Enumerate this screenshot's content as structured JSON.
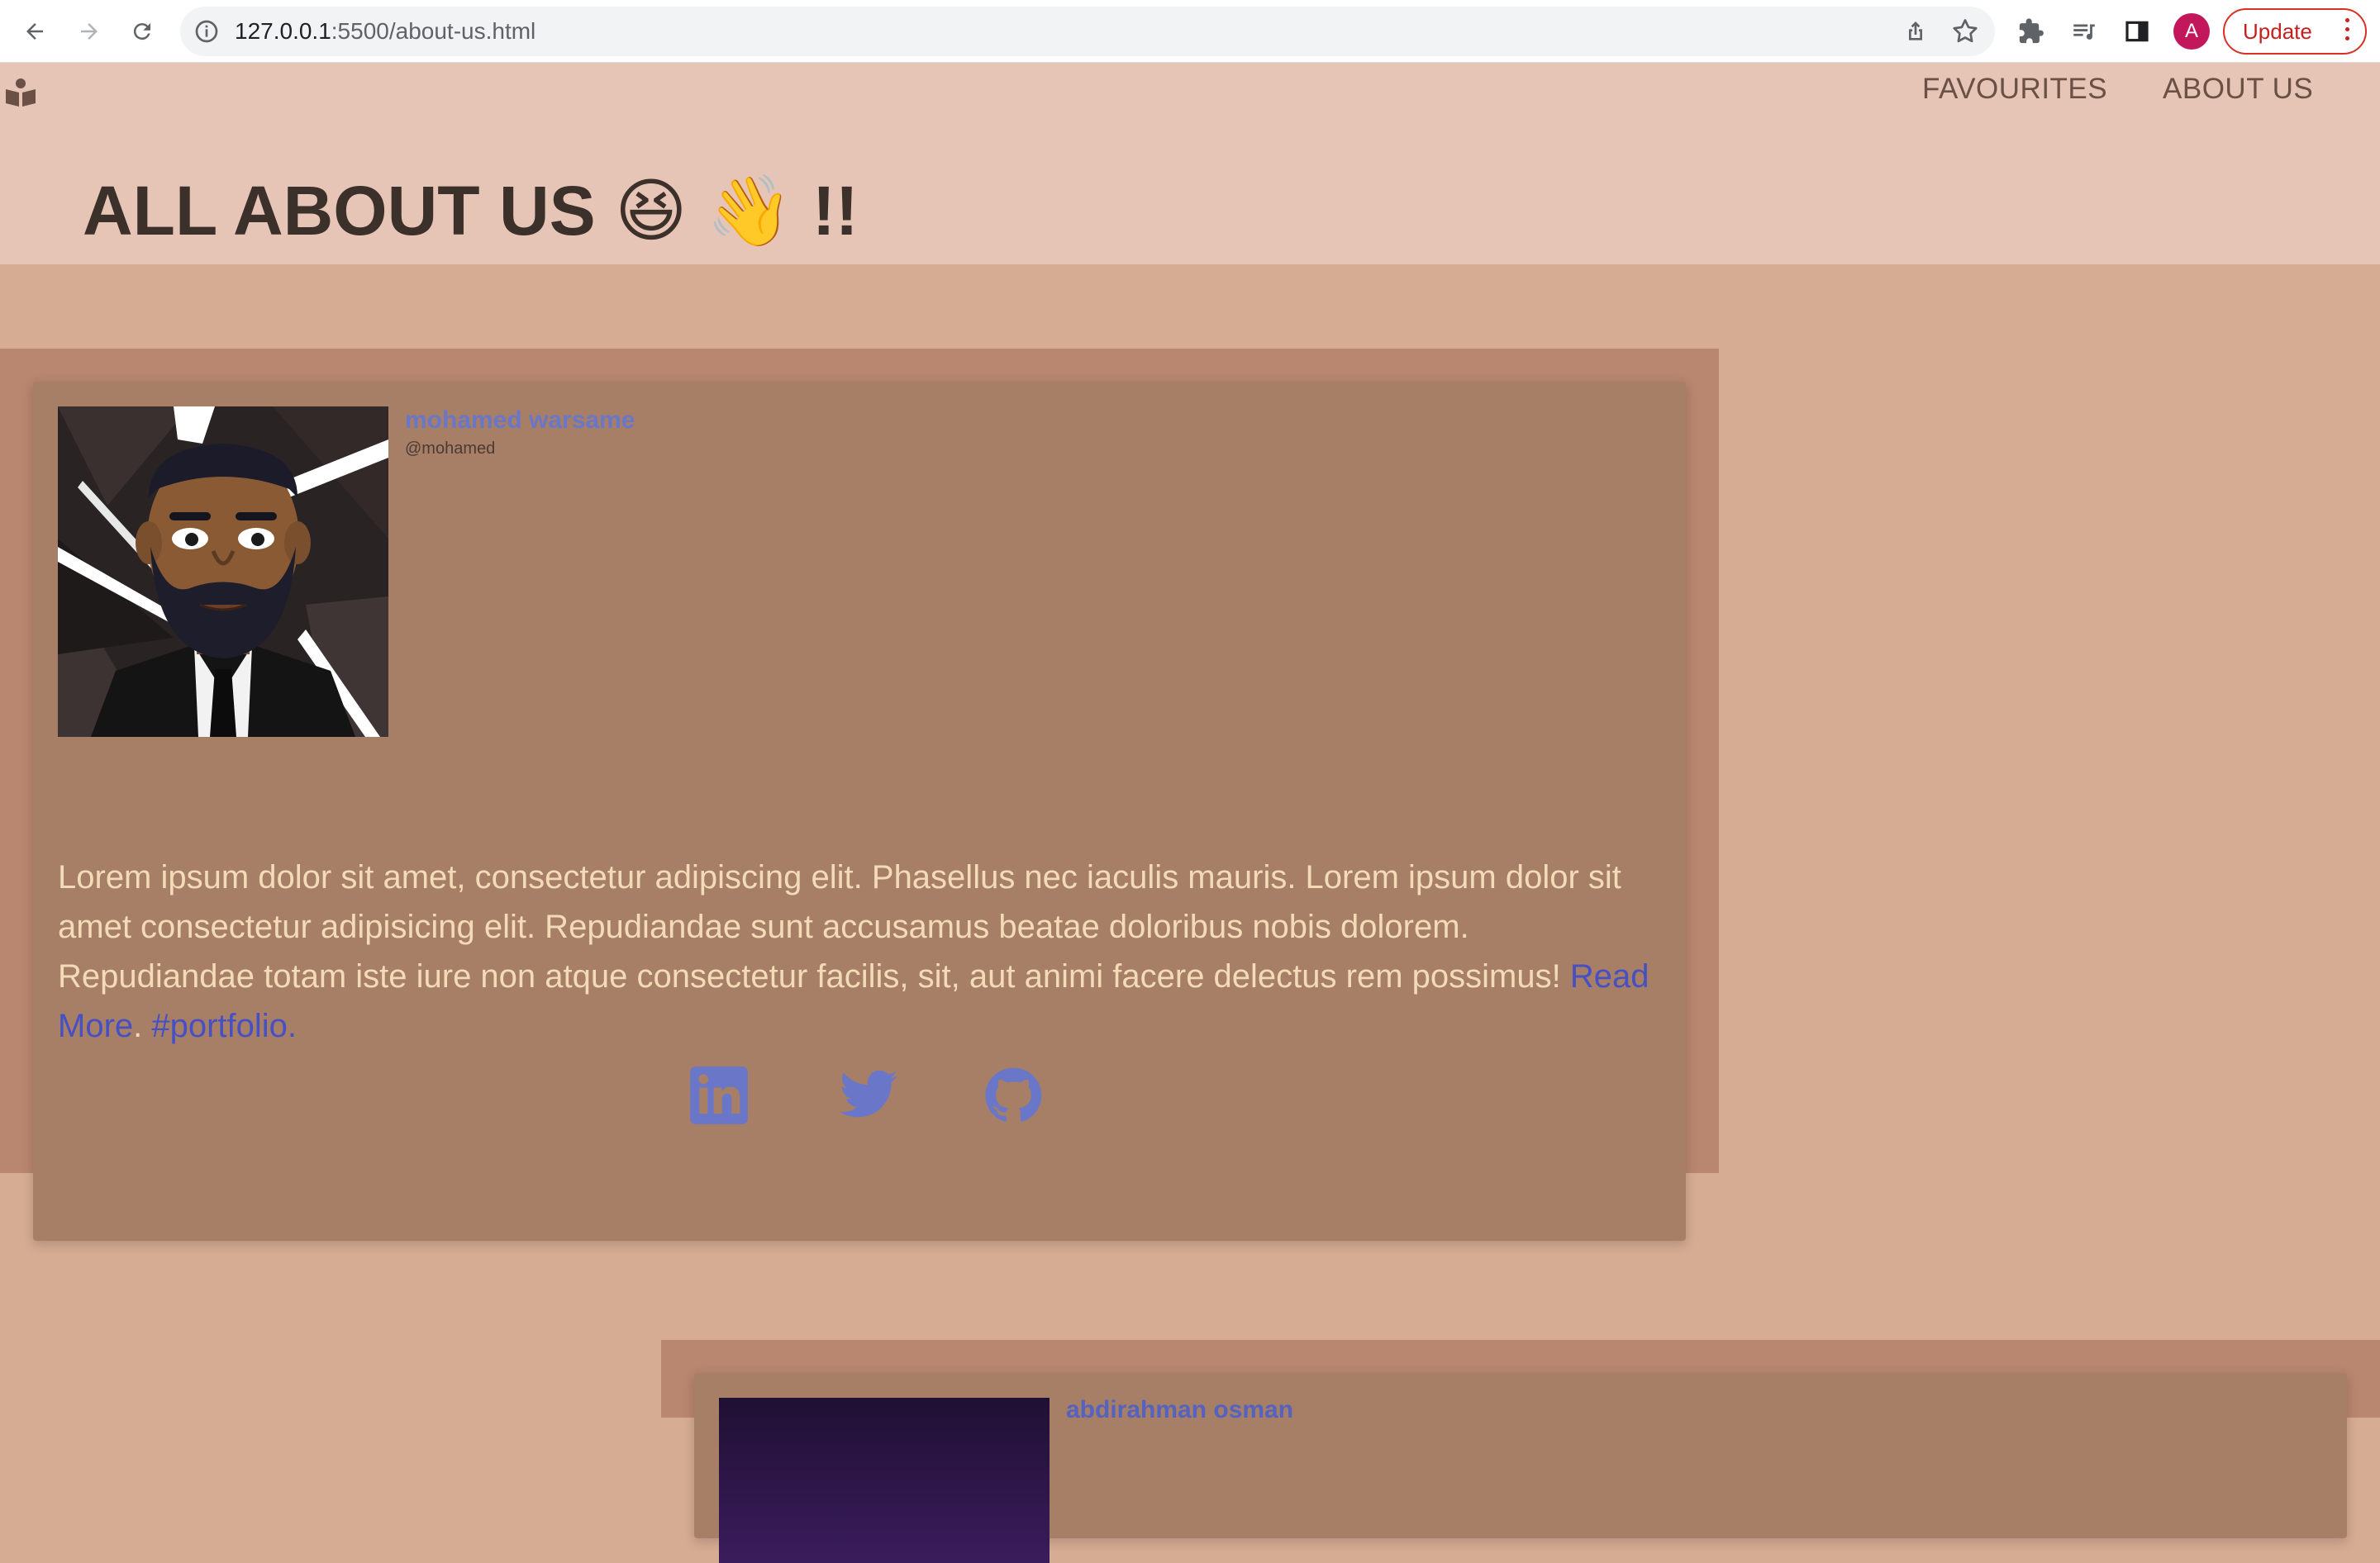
{
  "browser": {
    "url_host": "127.0.0.1",
    "url_path": ":5500/about-us.html",
    "profile_initial": "A",
    "update_label": "Update"
  },
  "nav": {
    "links": [
      "FAVOURITES",
      "ABOUT US"
    ]
  },
  "page": {
    "title": "ALL ABOUT US 😆 👋 !!"
  },
  "members": [
    {
      "name": "mohamed warsame",
      "handle": "@mohamed",
      "bio": "Lorem ipsum dolor sit amet, consectetur adipiscing elit. Phasellus nec iaculis mauris. Lorem ipsum dolor sit amet consectetur adipisicing elit. Repudiandae sunt accusamus beatae doloribus nobis dolorem. Repudiandae totam iste iure non atque consectetur facilis, sit, aut animi facere delectus rem possimus!",
      "read_more": "Read More",
      "separator": ". ",
      "hashtag": "#portfolio.",
      "socials": [
        "linkedin-icon",
        "twitter-icon",
        "github-icon"
      ]
    },
    {
      "name": "abdirahman osman"
    }
  ],
  "colors": {
    "navbar_bg": "#e6c4b6",
    "page_bg": "#d6ac93",
    "card_bg": "#a77e66",
    "bio_text": "#f3dbb8",
    "link": "#4650c3",
    "icon": "#6a77c8"
  }
}
